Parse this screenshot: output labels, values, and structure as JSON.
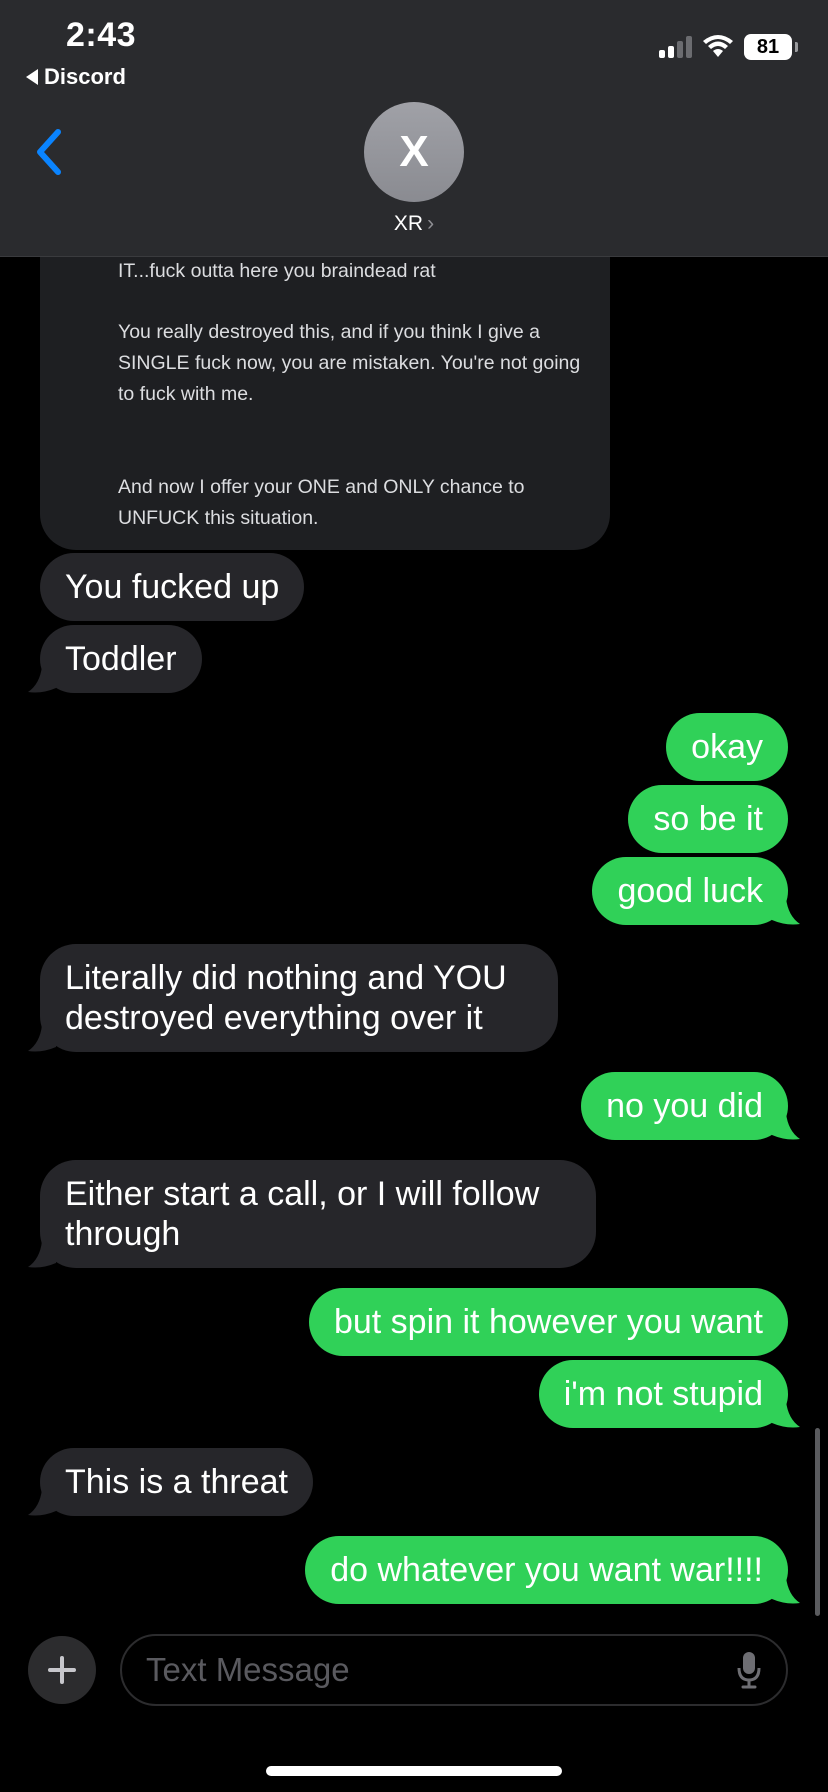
{
  "status": {
    "time": "2:43",
    "back_app": "Discord",
    "battery": "81"
  },
  "header": {
    "avatar_initial": "X",
    "contact_name": "XR"
  },
  "image_message": {
    "lines": [
      "IT...fuck outta here you braindead rat",
      "You really destroyed this, and if you think I give a SINGLE fuck now, you are mistaken. You're not going to fuck with me.",
      "And now I offer your ONE and ONLY chance to UNFUCK this situation."
    ]
  },
  "messages": [
    {
      "dir": "in",
      "text": "You fucked up"
    },
    {
      "dir": "in",
      "text": "Toddler"
    },
    {
      "dir": "out",
      "text": "okay"
    },
    {
      "dir": "out",
      "text": "so be it"
    },
    {
      "dir": "out",
      "text": "good luck"
    },
    {
      "dir": "in",
      "text": "Literally did nothing and YOU destroyed everything over it"
    },
    {
      "dir": "out",
      "text": "no you did"
    },
    {
      "dir": "in",
      "text": "Either start a call, or I will follow through"
    },
    {
      "dir": "out",
      "text": "but spin it however you want"
    },
    {
      "dir": "out",
      "text": "i'm not stupid"
    },
    {
      "dir": "in",
      "text": "This is a threat"
    },
    {
      "dir": "out",
      "text": "do whatever you want war!!!!"
    }
  ],
  "composer": {
    "placeholder": "Text Message"
  },
  "colors": {
    "outgoing": "#30d158",
    "incoming": "#26262a",
    "accent": "#0a84ff"
  }
}
